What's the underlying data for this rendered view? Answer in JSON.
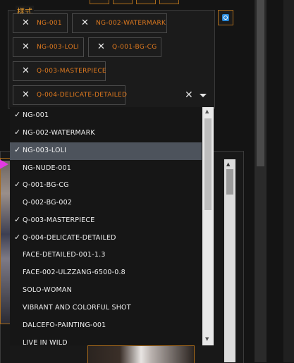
{
  "style_panel": {
    "label": "樣式",
    "selected_chips": [
      {
        "label": "NG-001"
      },
      {
        "label": "NG-002-WATERMARK"
      },
      {
        "label": "NG-003-LOLI"
      },
      {
        "label": "Q-001-BG-CG"
      },
      {
        "label": "Q-003-MASTERPIECE"
      },
      {
        "label": "Q-004-DELICATE-DETAILED"
      }
    ],
    "remove_glyph": "✕",
    "clear_glyph": "✕"
  },
  "dropdown": {
    "check_glyph": "✓",
    "options": [
      {
        "label": "NG-001",
        "checked": true,
        "highlighted": false
      },
      {
        "label": "NG-002-WATERMARK",
        "checked": true,
        "highlighted": false
      },
      {
        "label": "NG-003-LOLI",
        "checked": true,
        "highlighted": true
      },
      {
        "label": "NG-NUDE-001",
        "checked": false,
        "highlighted": false
      },
      {
        "label": "Q-001-BG-CG",
        "checked": true,
        "highlighted": false
      },
      {
        "label": "Q-002-BG-002",
        "checked": false,
        "highlighted": false
      },
      {
        "label": "Q-003-MASTERPIECE",
        "checked": true,
        "highlighted": false
      },
      {
        "label": "Q-004-DELICATE-DETAILED",
        "checked": true,
        "highlighted": false
      },
      {
        "label": "FACE-DETAILED-001-1.3",
        "checked": false,
        "highlighted": false
      },
      {
        "label": "FACE-002-ULZZANG-6500-0.8",
        "checked": false,
        "highlighted": false
      },
      {
        "label": "SOLO-WOMAN",
        "checked": false,
        "highlighted": false
      },
      {
        "label": "VIBRANT AND COLORFUL SHOT",
        "checked": false,
        "highlighted": false
      },
      {
        "label": "DALCEFO-PAINTING-001",
        "checked": false,
        "highlighted": false
      },
      {
        "label": "LIVE IN WILD",
        "checked": false,
        "highlighted": false
      }
    ]
  },
  "colors": {
    "accent": "#e07a1f",
    "highlight_row": "#4d535c",
    "refresh_icon": "#2b8ad9"
  }
}
